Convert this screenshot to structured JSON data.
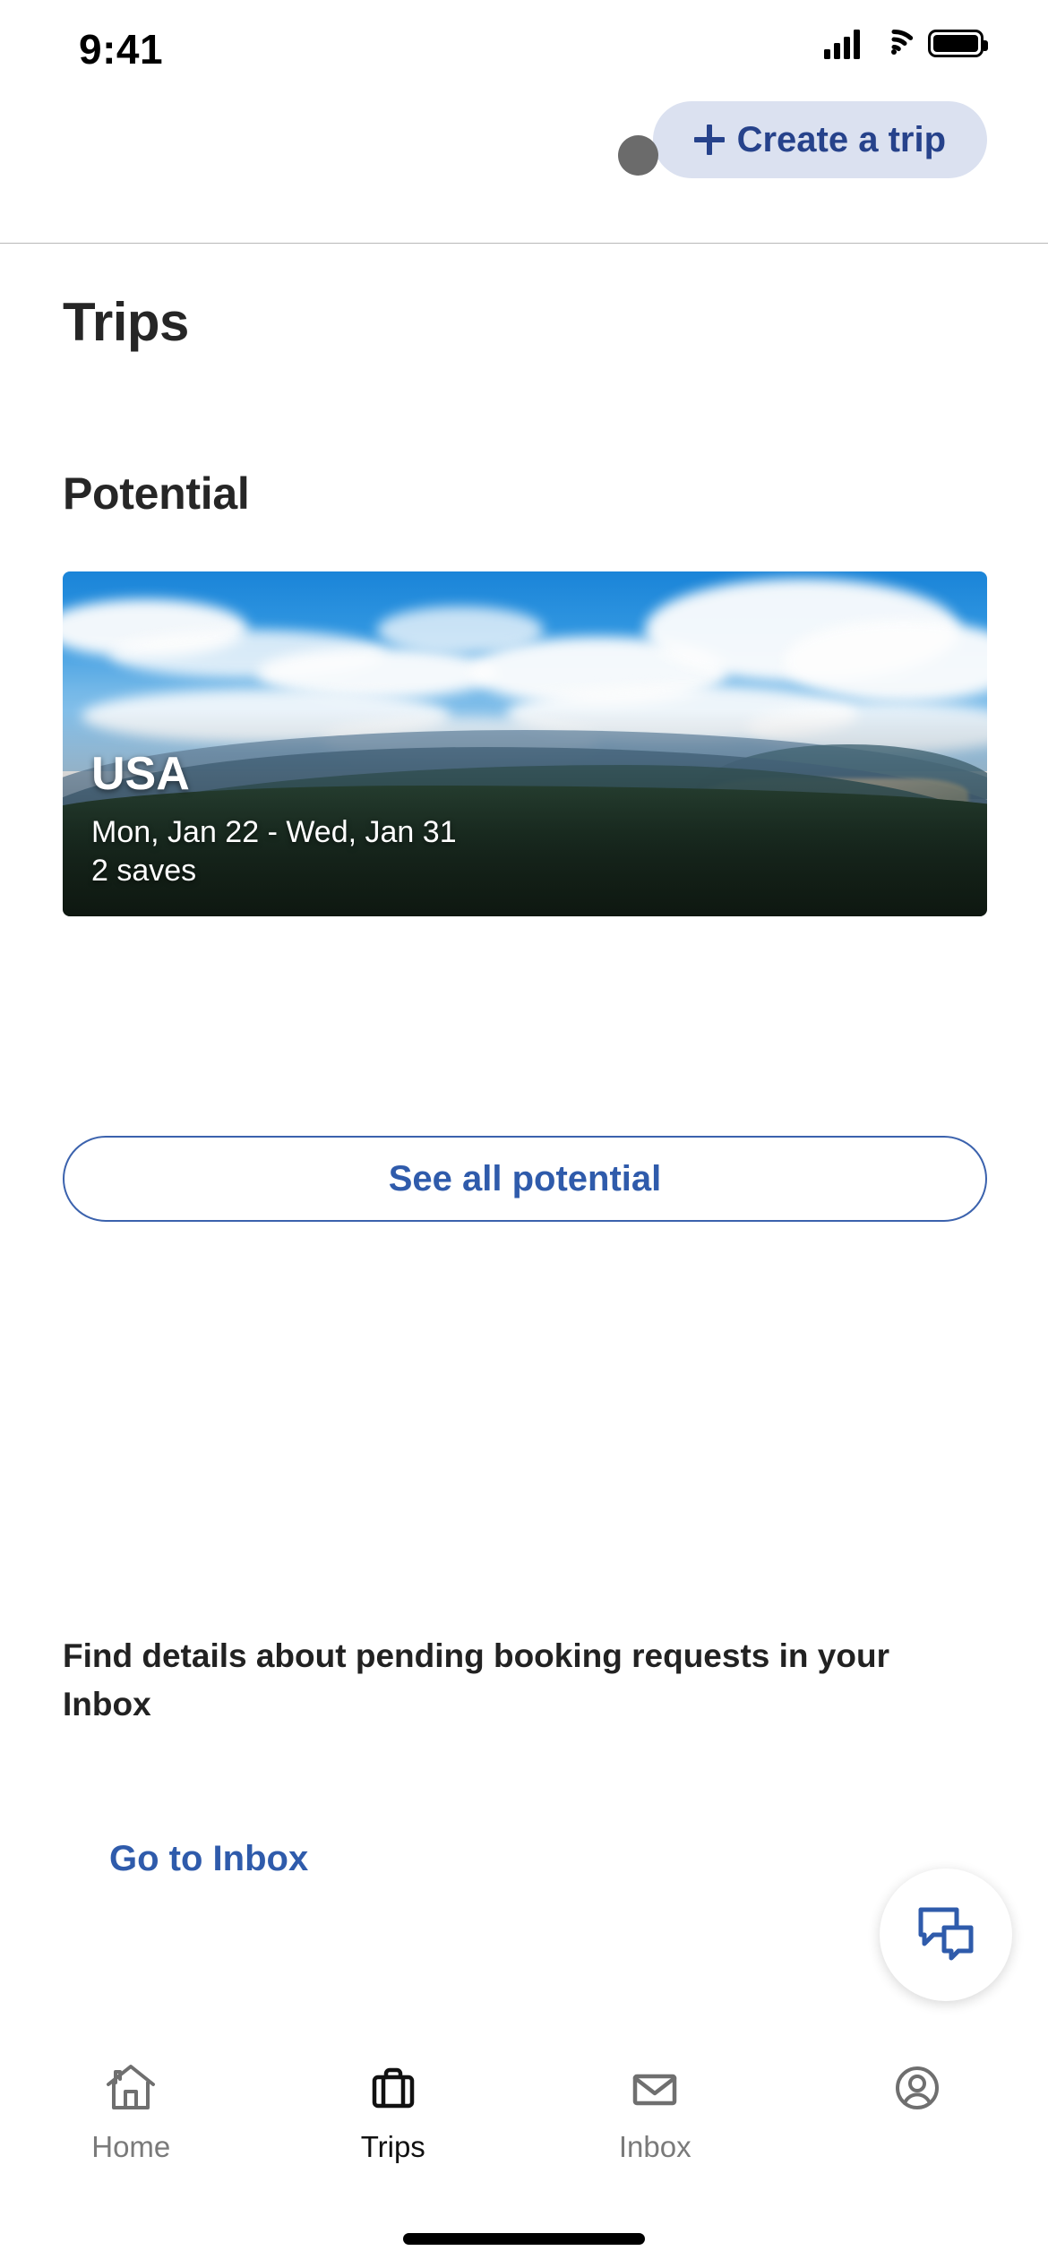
{
  "status_bar": {
    "time": "9:41",
    "signal_icon": "cellular-signal-icon",
    "wifi_icon": "wifi-icon",
    "battery_icon": "battery-icon"
  },
  "header": {
    "create_trip_label": "Create a trip",
    "plus_icon": "plus-icon"
  },
  "page": {
    "title": "Trips",
    "section_title": "Potential"
  },
  "trip_card": {
    "destination": "USA",
    "dates": "Mon, Jan 22 - Wed, Jan 31",
    "saves": "2 saves"
  },
  "see_all_button": {
    "label": "See all potential"
  },
  "inbox_prompt": {
    "message": "Find details about pending booking requests in your Inbox",
    "link_label": "Go to Inbox"
  },
  "chat_fab": {
    "icon": "chat-bubbles-icon"
  },
  "bottom_nav": {
    "items": [
      {
        "label": "Home",
        "icon": "house-icon",
        "active": false
      },
      {
        "label": "Trips",
        "icon": "briefcase-icon",
        "active": true
      },
      {
        "label": "Inbox",
        "icon": "envelope-icon",
        "active": false
      },
      {
        "label": "",
        "icon": "profile-icon",
        "active": false
      }
    ]
  },
  "colors": {
    "accent_blue": "#2f5bab",
    "button_navy": "#26428b",
    "button_bg": "#dbe1f0",
    "text_dark": "#262626",
    "text_muted": "#7a7a7a"
  }
}
